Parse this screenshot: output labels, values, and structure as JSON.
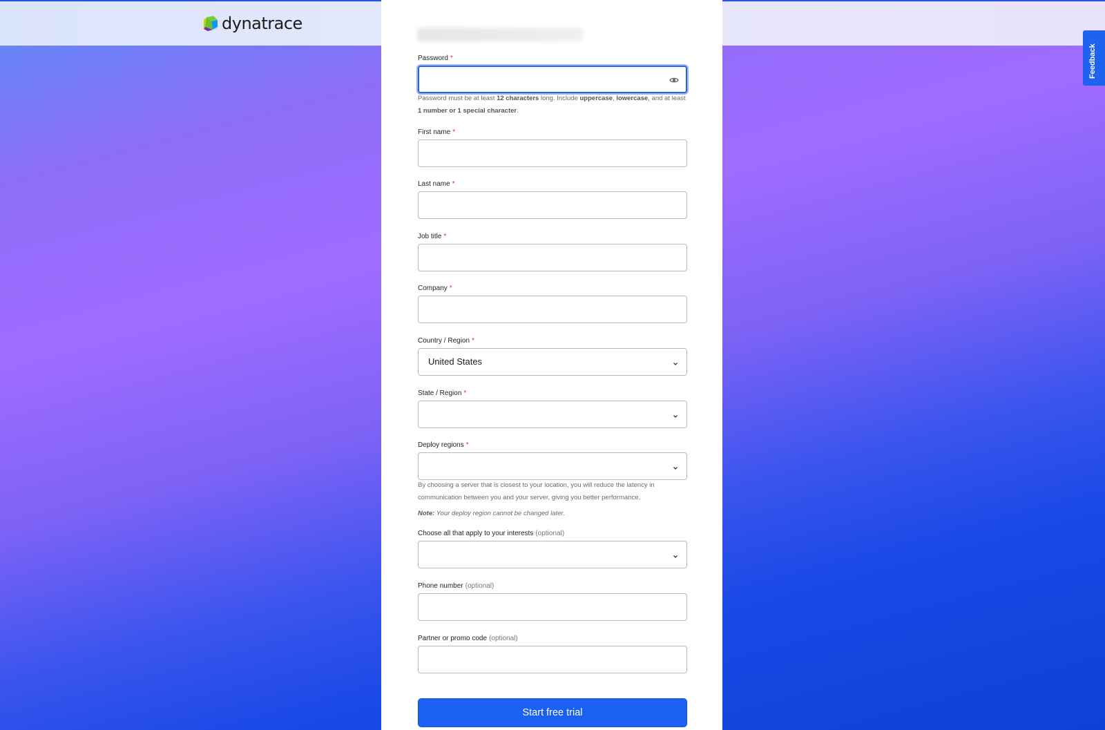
{
  "brand": {
    "logo_text": "dynatrace"
  },
  "feedback": {
    "label": "Feedback"
  },
  "form": {
    "password": {
      "label": "Password",
      "required": "*",
      "help_1": "Password must be at least ",
      "help_2": "12 characters",
      "help_3": " long. Include ",
      "help_4": "uppercase",
      "help_5": ", ",
      "help_6": "lowercase",
      "help_7": ", and at least ",
      "help_8": "1 number or 1 special character",
      "help_9": "."
    },
    "first_name": {
      "label": "First name",
      "required": "*"
    },
    "last_name": {
      "label": "Last name",
      "required": "*"
    },
    "job_title": {
      "label": "Job title",
      "required": "*"
    },
    "company": {
      "label": "Company",
      "required": "*"
    },
    "country": {
      "label": "Country / Region",
      "required": "*",
      "value": "United States"
    },
    "state": {
      "label": "State / Region",
      "required": "*",
      "value": ""
    },
    "deploy": {
      "label": "Deploy regions",
      "required": "*",
      "value": "",
      "help": "By choosing a server that is closest to your location, you will reduce the latency in communication between you and your server, giving you better performance.",
      "note_label": "Note:",
      "note_text": " Your deploy region cannot be changed later."
    },
    "interests": {
      "label": "Choose all that apply to your interests",
      "optional": "(optional)",
      "value": ""
    },
    "phone": {
      "label": "Phone number",
      "optional": "(optional)"
    },
    "promo": {
      "label": "Partner or promo code",
      "optional": "(optional)"
    },
    "submit_label": "Start free trial"
  },
  "colors": {
    "accent": "#1b60f3",
    "required": "#d9322c",
    "focus": "#2c63e6"
  }
}
